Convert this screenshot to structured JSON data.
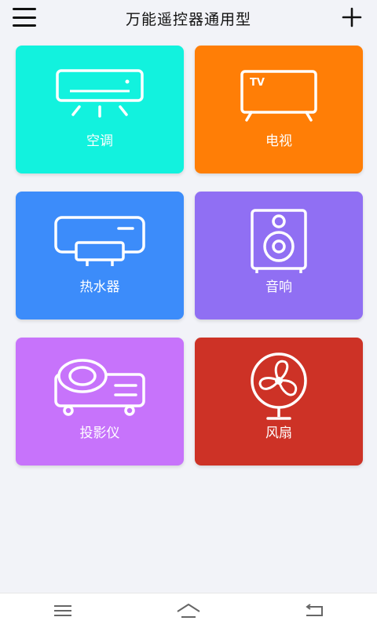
{
  "header": {
    "title": "万能遥控器通用型",
    "menu_icon": "hamburger-menu-icon",
    "add_icon": "plus-icon"
  },
  "devices": [
    {
      "label": "空调",
      "icon": "air-conditioner-icon",
      "color": "#12f2de"
    },
    {
      "label": "电视",
      "icon": "tv-icon",
      "color": "#ff7e06"
    },
    {
      "label": "热水器",
      "icon": "water-heater-icon",
      "color": "#3c8cfa"
    },
    {
      "label": "音响",
      "icon": "speaker-icon",
      "color": "#906ff3"
    },
    {
      "label": "投影仪",
      "icon": "projector-icon",
      "color": "#c773fb"
    },
    {
      "label": "风扇",
      "icon": "fan-icon",
      "color": "#cd3226"
    }
  ],
  "bottom_nav": {
    "menu_icon": "menu-lines-icon",
    "home_icon": "home-icon",
    "back_icon": "back-arrow-icon"
  }
}
